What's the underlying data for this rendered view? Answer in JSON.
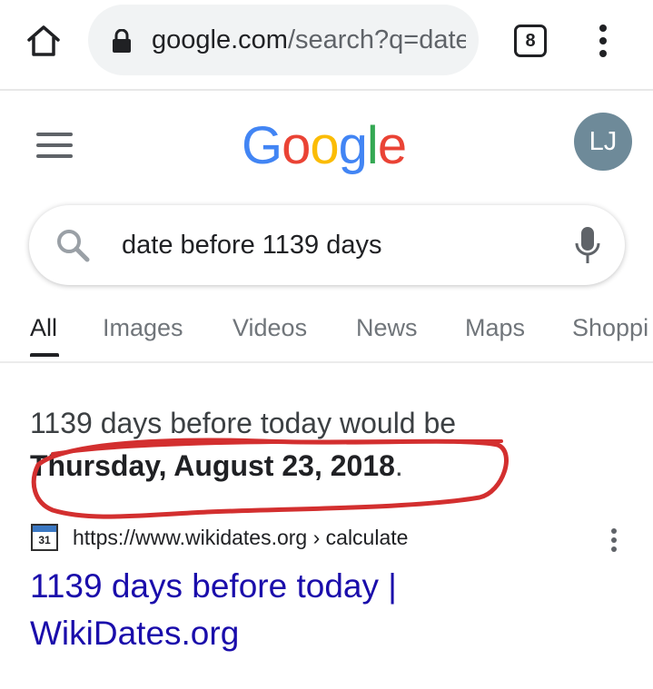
{
  "browser": {
    "url_domain": "google.com",
    "url_path": "/search?q=date",
    "tab_count": "8",
    "icons": [
      "home-icon",
      "lock-icon",
      "overflow-menu-icon"
    ]
  },
  "header": {
    "logo_letters": [
      "G",
      "o",
      "o",
      "g",
      "l",
      "e"
    ],
    "logo_colors": [
      "#4285F4",
      "#EA4335",
      "#FBBC05",
      "#4285F4",
      "#34A853",
      "#EA4335"
    ],
    "avatar_initials": "LJ",
    "avatar_color": "#6e8a99"
  },
  "search": {
    "query": "date before 1139 days"
  },
  "tabs": [
    {
      "label": "All",
      "active": true
    },
    {
      "label": "Images",
      "active": false
    },
    {
      "label": "Videos",
      "active": false
    },
    {
      "label": "News",
      "active": false
    },
    {
      "label": "Maps",
      "active": false
    },
    {
      "label": "Shoppi",
      "active": false
    }
  ],
  "answer": {
    "line1": "1139 days before today would be",
    "date": "Thursday, August 23, 2018",
    "period": ".",
    "annotation_color": "#d32f2f"
  },
  "result": {
    "favicon_text": "31",
    "url": "https://www.wikidates.org › calculate",
    "title_line1": "1139 days before today |",
    "title_line2": "WikiDates.org",
    "link_color": "#1a0dab"
  }
}
